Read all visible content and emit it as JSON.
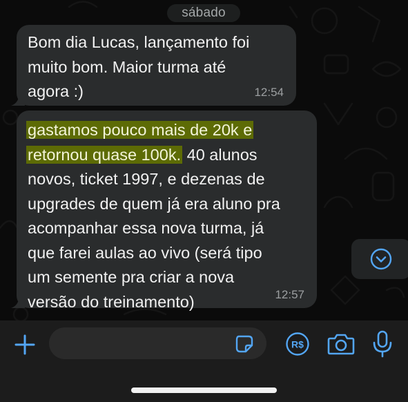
{
  "chat": {
    "date_label": "sábado",
    "messages": [
      {
        "text": "Bom dia Lucas, lançamento foi\nmuito bom. Maior turma até\nagora :)",
        "time": "12:54"
      },
      {
        "highlight_text": "gastamos pouco mais de 20k e\nretornou quase 100k.",
        "text": " 40 alunos\nnovos, ticket 1997, e dezenas de\nupgrades de quem já era aluno pra\nacompanhar essa nova turma, já\nque farei aulas ao vivo (será tipo\num semente pra criar a nova\nversão do treinamento)",
        "time": "12:57"
      }
    ]
  },
  "composer": {
    "placeholder": ""
  },
  "icons": {
    "attach": "plus-icon",
    "sticker": "sticker-icon",
    "payment": "brazilian-real-payment-icon",
    "camera": "camera-icon",
    "mic": "microphone-icon",
    "scroll": "chevron-down-circle-icon"
  },
  "colors": {
    "accent": "#53a6f4",
    "highlight": "#5d6b05",
    "bubble": "#2a2c2d",
    "background": "#0b0b0b"
  }
}
